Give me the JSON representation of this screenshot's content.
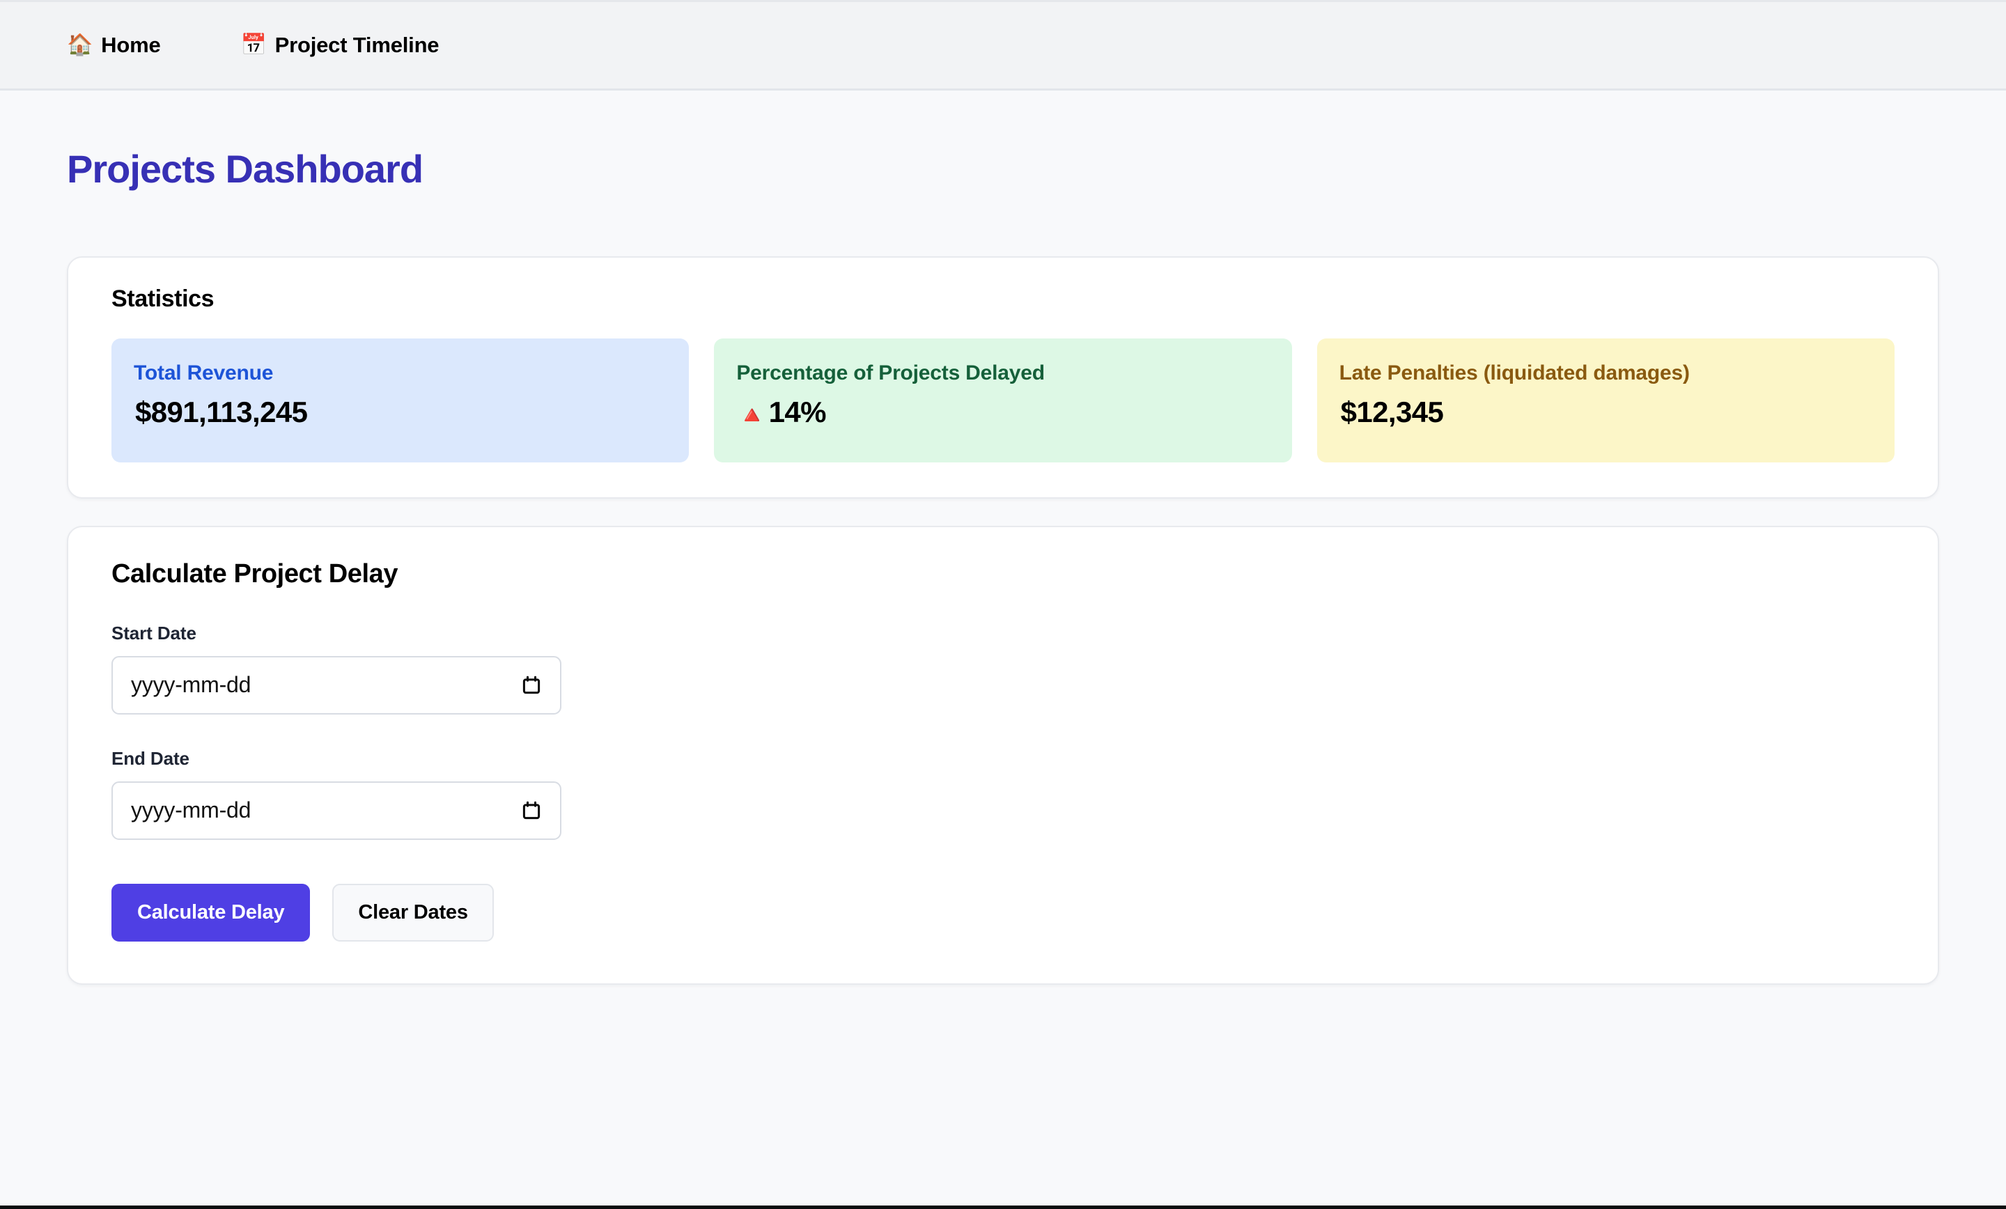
{
  "nav": {
    "items": [
      {
        "icon": "house-emoji",
        "glyph": "🏠",
        "label": "Home"
      },
      {
        "icon": "calendar-emoji",
        "glyph": "📅",
        "label": "Project Timeline"
      }
    ]
  },
  "page": {
    "title": "Projects Dashboard",
    "title_color": "#3730b5"
  },
  "statistics": {
    "heading": "Statistics",
    "tiles": [
      {
        "label": "Total Revenue",
        "value": "$891,113,245",
        "trend": "",
        "bg": "#dbe8fd",
        "label_color": "#1d54d7"
      },
      {
        "label": "Percentage of Projects Delayed",
        "value": "14%",
        "trend": "🔺",
        "bg": "#ddf8e5",
        "label_color": "#15603a"
      },
      {
        "label": "Late Penalties (liquidated damages)",
        "value": "$12,345",
        "trend": "",
        "bg": "#fcf6c8",
        "label_color": "#8a5a10"
      }
    ]
  },
  "delay_form": {
    "heading": "Calculate Project Delay",
    "start_date": {
      "label": "Start Date",
      "value": "",
      "placeholder": "yyyy-mm-dd"
    },
    "end_date": {
      "label": "End Date",
      "value": "",
      "placeholder": "yyyy-mm-dd"
    },
    "calculate_label": "Calculate Delay",
    "clear_label": "Clear Dates",
    "primary_color": "#4f3fe4"
  }
}
